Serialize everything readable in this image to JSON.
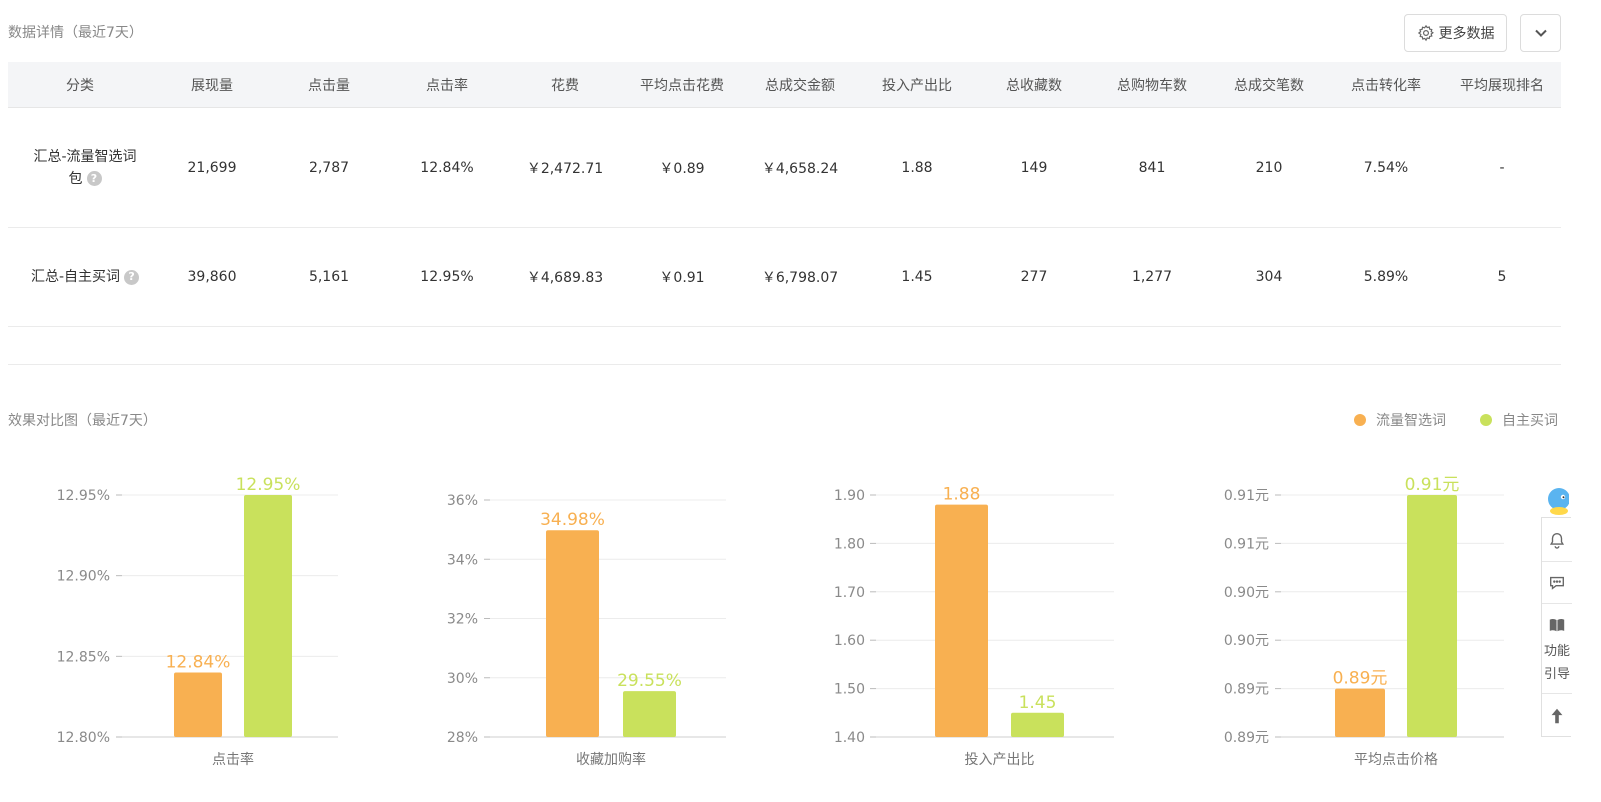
{
  "detail_section": {
    "title": "数据详情（最近7天）",
    "more_button": "更多数据"
  },
  "table": {
    "headers": [
      "分类",
      "展现量",
      "点击量",
      "点击率",
      "花费",
      "平均点击花费",
      "总成交金额",
      "投入产出比",
      "总收藏数",
      "总购物车数",
      "总成交笔数",
      "点击转化率",
      "平均展现排名"
    ],
    "rows": [
      {
        "name_line1": "汇总-流量智选词",
        "name_line2": "包",
        "help": "?",
        "values": [
          "21,699",
          "2,787",
          "12.84%",
          "￥2,472.71",
          "￥0.89",
          "￥4,658.24",
          "1.88",
          "149",
          "841",
          "210",
          "7.54%",
          "-"
        ]
      },
      {
        "name_line1": "汇总-自主买词",
        "name_line2": "",
        "help": "?",
        "values": [
          "39,860",
          "5,161",
          "12.95%",
          "￥4,689.83",
          "￥0.91",
          "￥6,798.07",
          "1.45",
          "277",
          "1,277",
          "304",
          "5.89%",
          "5"
        ]
      }
    ]
  },
  "compare_section": {
    "title": "效果对比图（最近7天）",
    "legend": [
      {
        "label": "流量智选词",
        "color": "#f8b051"
      },
      {
        "label": "自主买词",
        "color": "#c9e15c"
      }
    ]
  },
  "chart_data": [
    {
      "type": "bar",
      "xlabel": "点击率",
      "categories": [
        "流量智选词",
        "自主买词"
      ],
      "values": [
        12.84,
        12.95
      ],
      "value_labels": [
        "12.84%",
        "12.95%"
      ],
      "ylim": [
        12.8,
        12.95
      ],
      "yticks": [
        12.8,
        12.85,
        12.9,
        12.95
      ],
      "ytick_labels": [
        "12.80%",
        "12.85%",
        "12.90%",
        "12.95%"
      ],
      "grid": true
    },
    {
      "type": "bar",
      "xlabel": "收藏加购率",
      "categories": [
        "流量智选词",
        "自主买词"
      ],
      "values": [
        34.98,
        29.55
      ],
      "value_labels": [
        "34.98%",
        "29.55%"
      ],
      "ylim": [
        28,
        36
      ],
      "yticks": [
        28,
        30,
        32,
        34,
        36
      ],
      "ytick_labels": [
        "28%",
        "30%",
        "32%",
        "34%",
        "36%"
      ],
      "grid": true
    },
    {
      "type": "bar",
      "xlabel": "投入产出比",
      "categories": [
        "流量智选词",
        "自主买词"
      ],
      "values": [
        1.88,
        1.45
      ],
      "value_labels": [
        "1.88",
        "1.45"
      ],
      "ylim": [
        1.4,
        1.9
      ],
      "yticks": [
        1.4,
        1.5,
        1.6,
        1.7,
        1.8,
        1.9
      ],
      "ytick_labels": [
        "1.40",
        "1.50",
        "1.60",
        "1.70",
        "1.80",
        "1.90"
      ],
      "grid": true
    },
    {
      "type": "bar",
      "xlabel": "平均点击价格",
      "categories": [
        "流量智选词",
        "自主买词"
      ],
      "values": [
        0.89,
        0.91
      ],
      "value_labels": [
        "0.89元",
        "0.91元"
      ],
      "ylim": [
        0.885,
        0.91
      ],
      "yticks": [
        0.885,
        0.89,
        0.895,
        0.9,
        0.905,
        0.91
      ],
      "ytick_labels": [
        "0.89元",
        "0.89元",
        "0.90元",
        "0.90元",
        "0.91元",
        "0.91元"
      ],
      "grid": true
    }
  ],
  "side_toolbar": {
    "guide_label_1": "功能",
    "guide_label_2": "引导"
  }
}
